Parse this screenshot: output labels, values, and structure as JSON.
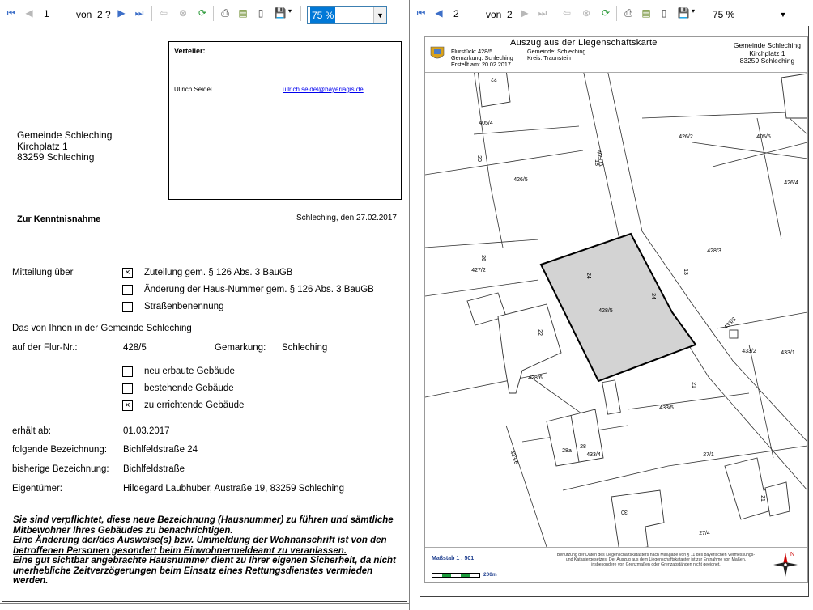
{
  "left_toolbar": {
    "page_current": "1",
    "page_of_text": "von",
    "page_total": "2 ?",
    "zoom_value": "75 %"
  },
  "right_toolbar": {
    "page_current": "2",
    "page_of_text": "von",
    "page_total": "2",
    "zoom_value": "75 %"
  },
  "letter": {
    "verteiler_title": "Verteiler:",
    "verteiler_name": "Ullrich Seidel",
    "verteiler_email": "ullrich.seidel@bayeriagis.de",
    "recipient_line1": "Gemeinde Schleching",
    "recipient_line2": "Kirchplatz 1",
    "recipient_line3": "83259 Schleching",
    "subject": "Zur Kenntnisnahme",
    "date_line": "Schleching, den 27.02.2017",
    "mitteilung_label": "Mitteilung über",
    "options": [
      {
        "label": "Zuteilung gem. § 126 Abs. 3 BauGB",
        "checked": "×"
      },
      {
        "label": "Änderung der Haus-Nummer gem. § 126 Abs. 3 BauGB",
        "checked": ""
      },
      {
        "label": "Straßenbenennung",
        "checked": ""
      }
    ],
    "gemeinde_sentence": "Das von Ihnen in der Gemeinde Schleching",
    "flur_label": "auf der Flur-Nr.:",
    "flur_value": "428/5",
    "gemarkung_label": "Gemarkung:",
    "gemarkung_value": "Schleching",
    "building_options": [
      {
        "label": "neu erbaute Gebäude",
        "checked": ""
      },
      {
        "label": "bestehende Gebäude",
        "checked": ""
      },
      {
        "label": "zu errichtende Gebäude",
        "checked": "×"
      }
    ],
    "erhaelt_label": "erhält ab:",
    "erhaelt_value": "01.03.2017",
    "folgende_label": "folgende Bezeichnung:",
    "folgende_value": "Bichlfeldstraße 24",
    "bisherige_label": "bisherige Bezeichnung:",
    "bisherige_value": "Bichlfeldstraße",
    "eigentuemer_label": "Eigentümer:",
    "eigentuemer_value": "Hildegard Laubhuber, Austraße 19, 83259 Schleching",
    "notice_1": "Sie sind verpflichtet, diese neue Bezeichnung (Hausnummer) zu führen und sämtliche Mitbewohner Ihres Gebäudes zu benachrichtigen.",
    "notice_2": "Eine Änderung der/des Ausweise(s) bzw. Ummeldung der Wohnanschrift ist von den betroffenen Personen gesondert beim Einwohnermeldeamt zu veranlassen.",
    "notice_3": "Eine gut sichtbar angebrachte Hausnummer dient zu Ihrer eigenen Sicherheit, da nicht unerhebliche Zeitverzögerungen beim Einsatz eines Rettungsdienstes vermieden werden."
  },
  "map": {
    "title": "Auszug aus der Liegenschaftskarte",
    "flurstueck": "Flurstück: 428/5",
    "gemarkung": "Gemarkung: Schleching",
    "erstellt": "Erstellt am: 20.02.2017",
    "gemeinde": "Gemeinde: Schleching",
    "kreis": "Kreis: Traunstein",
    "org_line1": "Gemeinde Schleching",
    "org_line2": "Kirchplatz 1",
    "org_line3": "83259 Schleching",
    "scale": "Maßstab 1 : 501",
    "scale_bar_label": "200m",
    "footer_note": "Benutzung der Daten des Liegenschaftskatasters nach Maßgabe von § 11 des bayerischen Vermessungs- und Katastergesetzes. Der Auszug aus dem Liegenschaftskataster ist zur Entnahme von Maßen, insbesondere von Grenzmaßen oder Grenzabständen nicht geeignet.",
    "north_label": "N",
    "parcel_labels": [
      "405/4",
      "426/2",
      "405/5",
      "426/5",
      "426/4",
      "428/3",
      "427/2",
      "428/5",
      "433/3",
      "433/2",
      "433/1",
      "428/6",
      "433/5",
      "433/4",
      "433/6",
      "27/1",
      "27/4",
      "405/11"
    ],
    "house_numbers": [
      "22",
      "18",
      "20",
      "13",
      "24",
      "22",
      "28a",
      "28",
      "26",
      "30",
      "21",
      "21",
      "24"
    ],
    "highlight_fill": "#d3d3d3"
  }
}
